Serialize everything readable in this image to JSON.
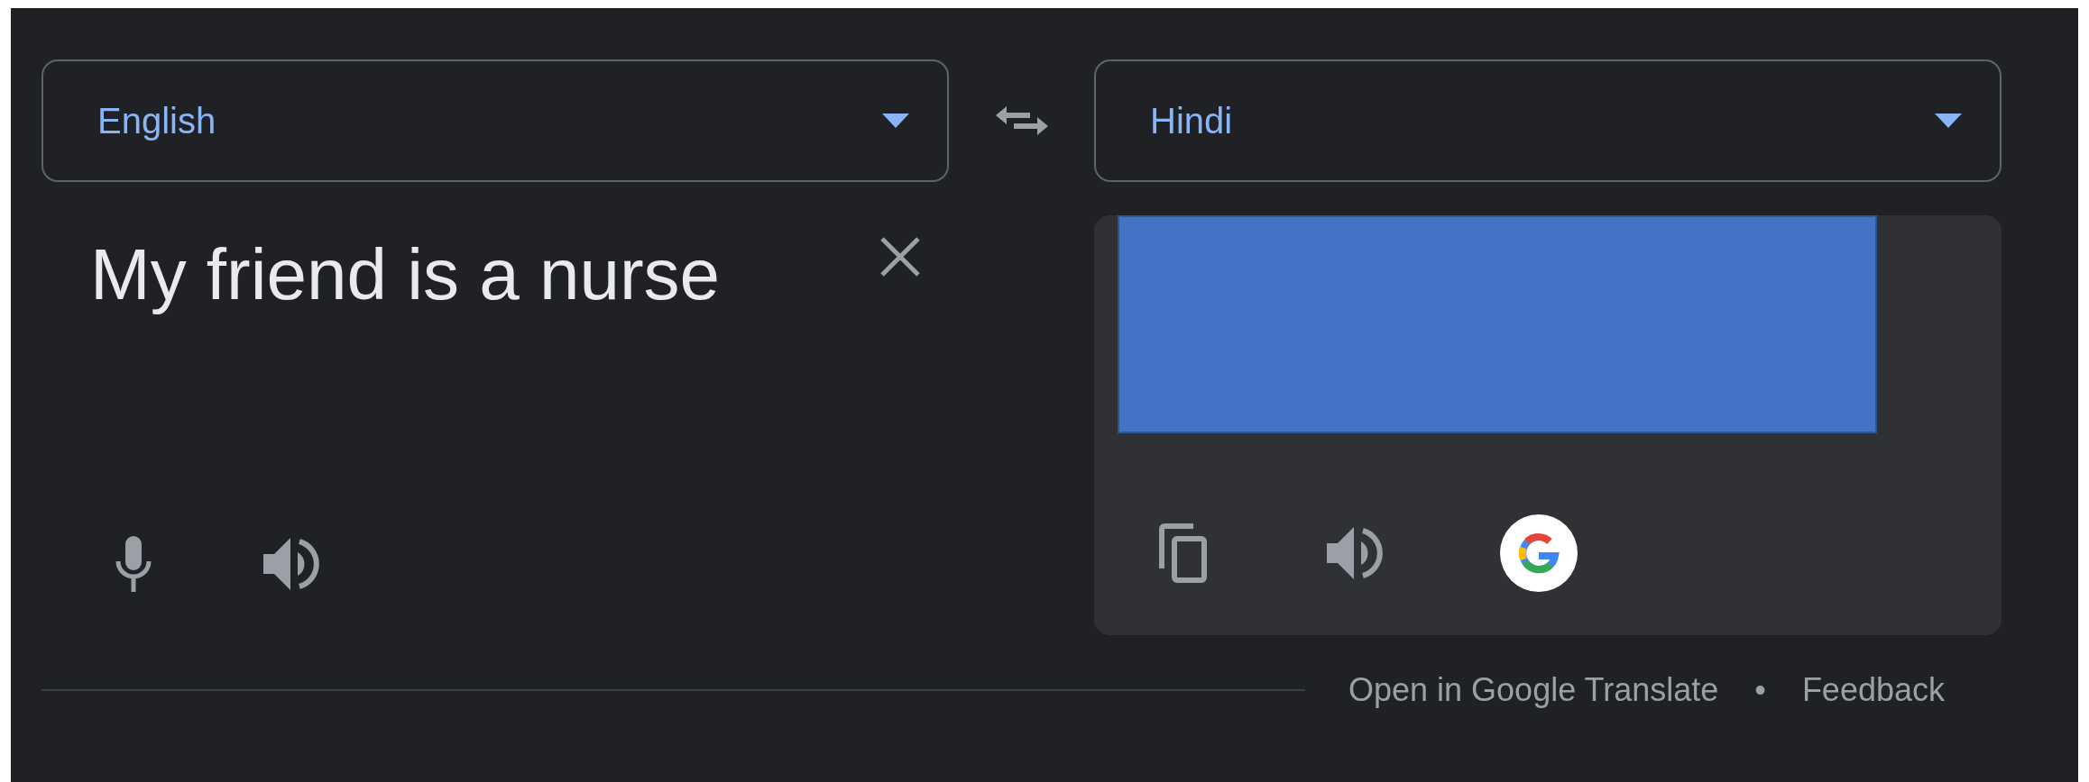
{
  "source_language": {
    "label": "English"
  },
  "target_language": {
    "label": "Hindi"
  },
  "input": {
    "value": "My friend is a nurse"
  },
  "output": {
    "redacted": true
  },
  "footer": {
    "links": [
      "Open in Google Translate",
      "Feedback"
    ],
    "separator": "•"
  }
}
